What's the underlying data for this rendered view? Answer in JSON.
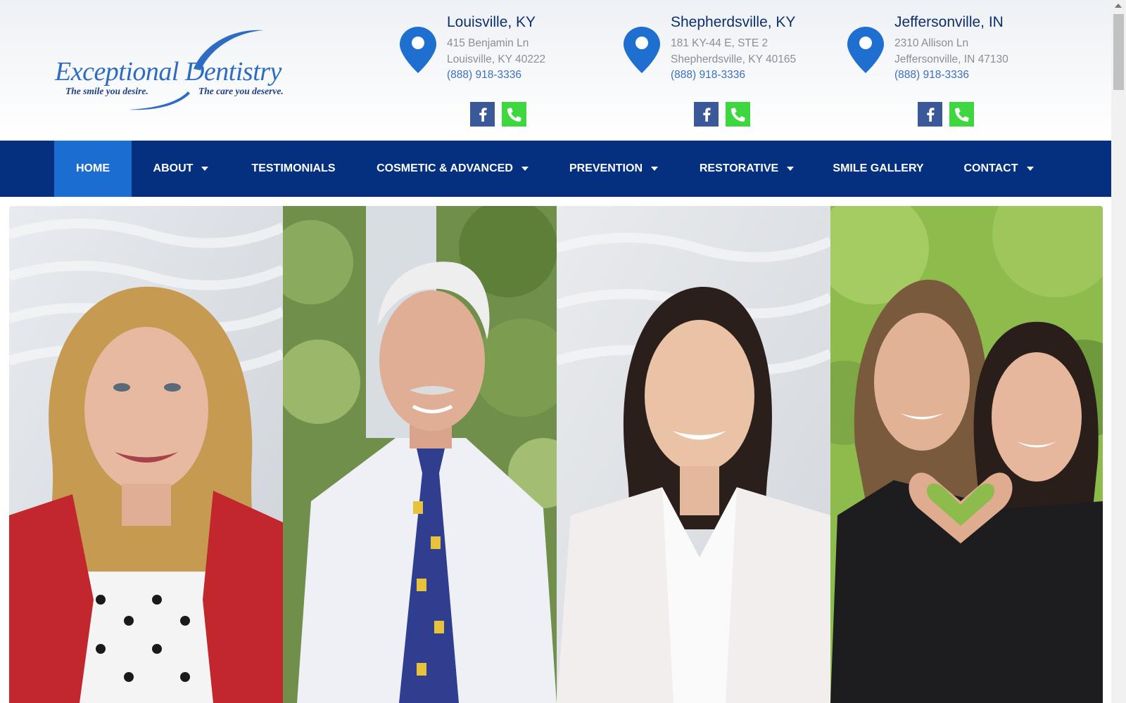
{
  "brand": {
    "name": "Exceptional Dentistry",
    "tagline_left": "The smile you desire.",
    "tagline_right": "The care you deserve.",
    "color": "#2e6cc4"
  },
  "locations": [
    {
      "title": "Louisville, KY",
      "street": "415 Benjamin Ln",
      "city": "Louisville, KY 40222",
      "phone": "(888) 918-3336"
    },
    {
      "title": "Shepherdsville, KY",
      "street": "181 KY-44 E, STE 2",
      "city": "Shepherdsville, KY 40165",
      "phone": "(888) 918-3336"
    },
    {
      "title": "Jeffersonville, IN",
      "street": "2310 Allison Ln",
      "city": "Jeffersonville, IN 47130",
      "phone": "(888) 918-3336"
    }
  ],
  "nav": {
    "items": [
      {
        "label": "HOME",
        "active": true,
        "dropdown": false
      },
      {
        "label": "ABOUT",
        "active": false,
        "dropdown": true
      },
      {
        "label": "TESTIMONIALS",
        "active": false,
        "dropdown": false
      },
      {
        "label": "COSMETIC & ADVANCED",
        "active": false,
        "dropdown": true
      },
      {
        "label": "PREVENTION",
        "active": false,
        "dropdown": true
      },
      {
        "label": "RESTORATIVE",
        "active": false,
        "dropdown": true
      },
      {
        "label": "SMILE GALLERY",
        "active": false,
        "dropdown": false
      },
      {
        "label": "CONTACT",
        "active": false,
        "dropdown": true
      }
    ]
  },
  "hero": {
    "photos": [
      "photo-woman-red-jacket",
      "photo-man-white-hair-tie",
      "photo-woman-white-coat",
      "photo-two-women-heart-hands"
    ]
  },
  "colors": {
    "nav_bg": "#04307f",
    "nav_active": "#1c6dd1",
    "pin": "#1e6fd0",
    "facebook": "#3b5998",
    "phone_button": "#3fd73f"
  },
  "icons": {
    "location": "map-pin-icon",
    "facebook": "facebook-icon",
    "phone": "phone-icon"
  }
}
